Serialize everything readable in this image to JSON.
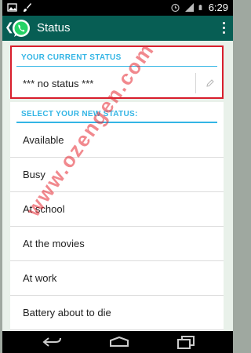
{
  "status_bar": {
    "time": "6:29",
    "left_icons": [
      "gallery-icon",
      "brush-icon"
    ],
    "right_icons": [
      "alarm-icon",
      "signal-icon",
      "battery-icon"
    ]
  },
  "action_bar": {
    "title": "Status",
    "logo_icon": "whatsapp-logo-icon",
    "back_icon": "chevron-left-icon",
    "menu_icon": "overflow-menu-icon",
    "color": "#075e54"
  },
  "current_status": {
    "header": "YOUR CURRENT STATUS",
    "value": "*** no status ***",
    "edit_icon": "pencil-icon",
    "highlight_color": "#d81e2c"
  },
  "new_status": {
    "header": "SELECT YOUR NEW STATUS:",
    "options": [
      "Available",
      "Busy",
      "At school",
      "At the movies",
      "At work",
      "Battery about to die"
    ]
  },
  "watermark": "www.ozengen.com",
  "accent_color": "#33b5e5",
  "nav_bar": {
    "buttons": [
      "back-icon",
      "home-icon",
      "recent-apps-icon"
    ]
  }
}
